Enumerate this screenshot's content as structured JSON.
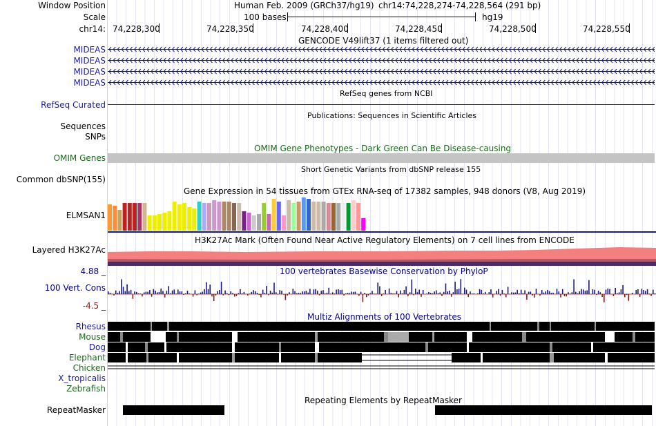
{
  "header": {
    "window_position_label": "Window Position",
    "scale_label": "Scale",
    "chrom_label": "chr14:",
    "assembly": "Human Feb. 2009 (GRCh37/hg19)",
    "position": "chr14:74,228,274-74,228,564 (291 bp)",
    "scale_text": "100 bases",
    "db": "hg19",
    "ticks": [
      "74,228,300",
      "74,228,350",
      "74,228,400",
      "74,228,450",
      "74,228,500",
      "74,228,550"
    ]
  },
  "gencode": {
    "title": "GENCODE V49lift37 (1 items filtered out)",
    "items": [
      "MIDEAS",
      "MIDEAS",
      "MIDEAS",
      "MIDEAS"
    ]
  },
  "refseq": {
    "title": "RefSeq genes from NCBI",
    "label": "RefSeq Curated"
  },
  "publications": {
    "title": "Publications: Sequences in Scientific Articles",
    "labels": [
      "Sequences",
      "SNPs"
    ]
  },
  "omim": {
    "title": "OMIM Gene Phenotypes - Dark Green Can Be Disease-causing",
    "label": "OMIM Genes"
  },
  "dbsnp": {
    "title": "Short Genetic Variants from dbSNP release 155",
    "label": "Common dbSNP(155)"
  },
  "gtex": {
    "title": "Gene Expression in 54 tissues from GTEx RNA-seq of 17382 samples, 948 donors (V8, Aug 2019)",
    "label": "ELMSAN1",
    "colors": [
      "#ff9933",
      "#ff8c3a",
      "#c4a35a",
      "#bb2222",
      "#bb2222",
      "#bb2222",
      "#aa3366",
      "#d4b48e",
      "#eeee00",
      "#eeee00",
      "#eeee00",
      "#eeee00",
      "#eeee00",
      "#eeee00",
      "#eeee00",
      "#eeee00",
      "#eeee00",
      "#eeee00",
      "#33cccc",
      "#aaaaff",
      "#cc99bb",
      "#cc99cc",
      "#cc99cc",
      "#aa8866",
      "#aa8866",
      "#886655",
      "#ccbbaa",
      "#772288",
      "#cc66cc",
      "#cccccc",
      "#aaaaaa",
      "#99cc33",
      "#cc66aa",
      "#ffcc33",
      "#6666ff",
      "#ff99cc",
      "#ccbbaa",
      "#99ff99",
      "#cc9966",
      "#5599ff",
      "#3366cc",
      "#ccbbaa",
      "#ccbbaa",
      "#aaaaaa",
      "#dd8899",
      "#996633",
      "#aaaaaa",
      "#eeeeee",
      "#009933",
      "#ffcccc",
      "#ff9999",
      "#ff00ff"
    ],
    "values": [
      38,
      36,
      30,
      40,
      40,
      40,
      40,
      40,
      22,
      22,
      24,
      26,
      28,
      42,
      38,
      40,
      34,
      32,
      42,
      40,
      40,
      44,
      42,
      42,
      42,
      40,
      40,
      28,
      26,
      22,
      24,
      40,
      24,
      46,
      42,
      22,
      44,
      40,
      42,
      48,
      46,
      42,
      42,
      42,
      40,
      40,
      40,
      40,
      40,
      44,
      40,
      18
    ]
  },
  "h3k27ac": {
    "title": "H3K27Ac Mark (Often Found Near Active Regulatory Elements) on 7 cell lines from ENCODE",
    "label": "Layered H3K27Ac"
  },
  "phylop": {
    "title": "100 vertebrates Basewise Conservation by PhyloP",
    "label": "100 Vert. Cons",
    "max": "4.88 _",
    "min": "-4.5 _"
  },
  "multiz": {
    "title": "Multiz Alignments of 100 Vertebrates",
    "species": [
      {
        "name": "Rhesus",
        "color": "blue"
      },
      {
        "name": "Mouse",
        "color": "green"
      },
      {
        "name": "Dog",
        "color": "blue"
      },
      {
        "name": "Elephant",
        "color": "green"
      },
      {
        "name": "Chicken",
        "color": "green"
      },
      {
        "name": "X_tropicalis",
        "color": "blue"
      },
      {
        "name": "Zebrafish",
        "color": "green"
      }
    ]
  },
  "repeatmasker": {
    "title": "Repeating Elements by RepeatMasker",
    "label": "RepeatMasker"
  }
}
